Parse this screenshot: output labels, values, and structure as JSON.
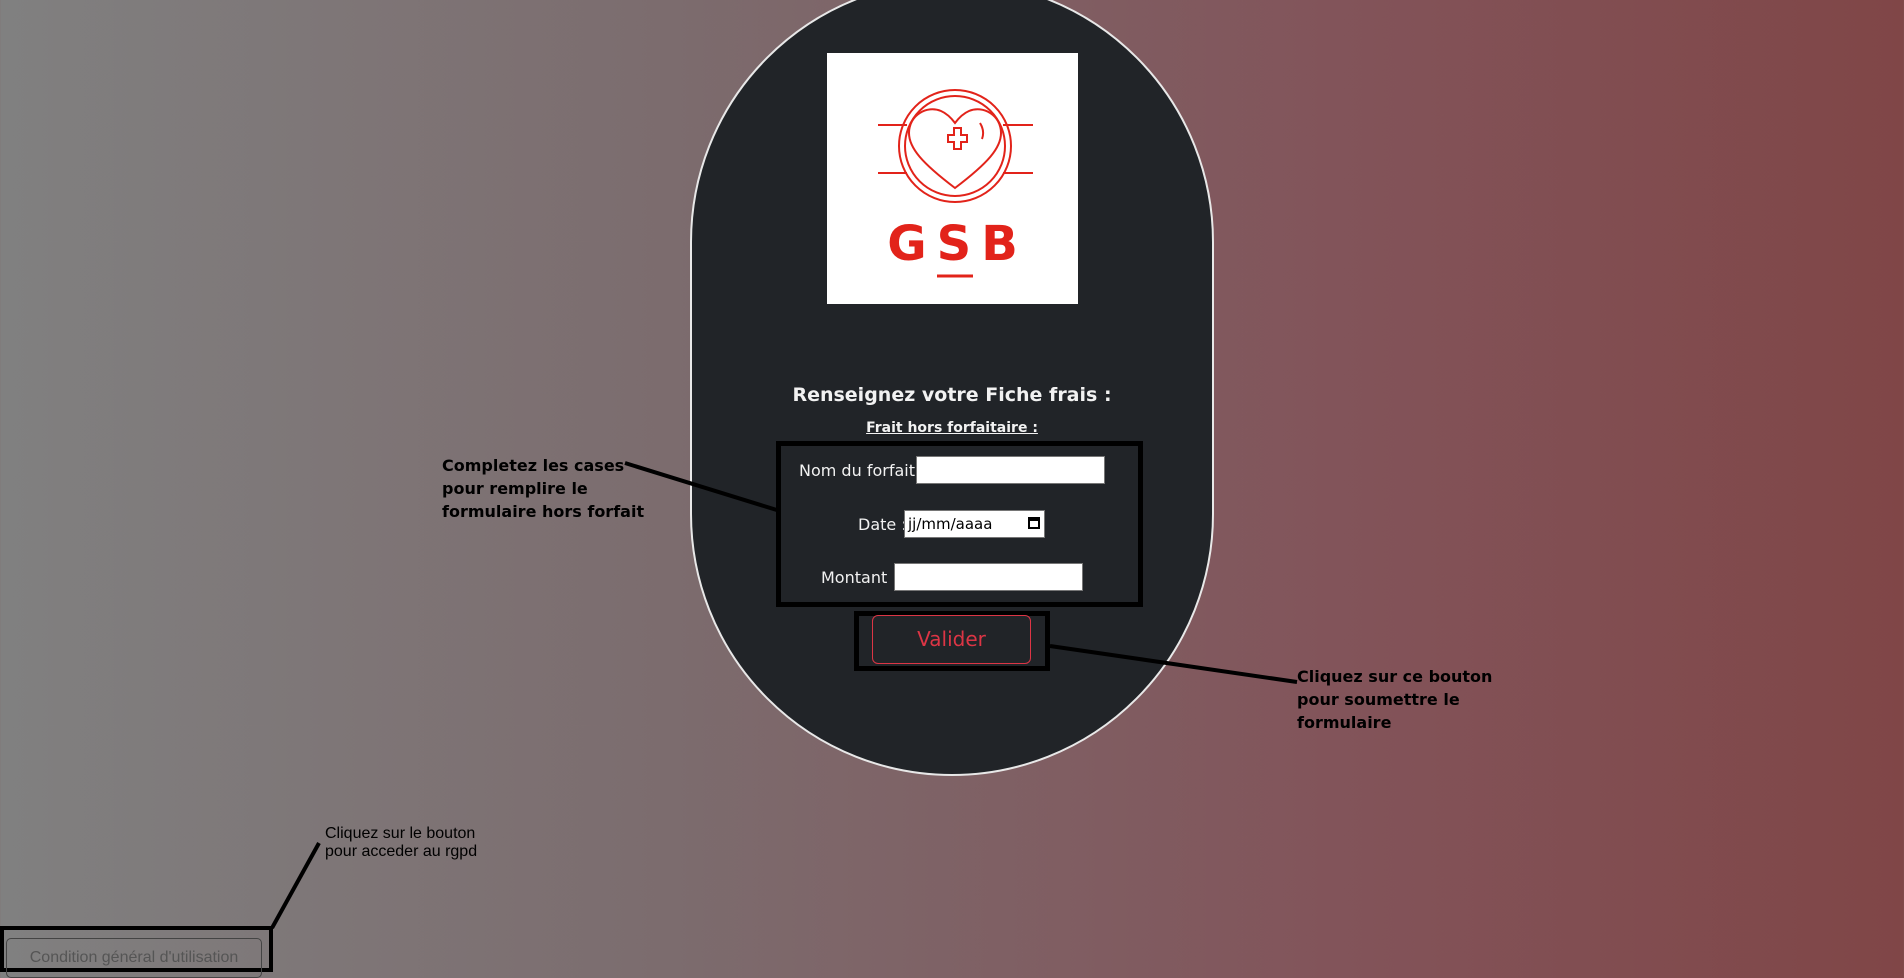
{
  "logo": {
    "text": "GSB",
    "color": "#e2231a"
  },
  "form": {
    "heading": "Renseignez votre Fiche frais :",
    "subheading": "Frait hors forfaitaire :",
    "fields": [
      {
        "label": "Nom du forfait :",
        "value": ""
      },
      {
        "label": "Date :",
        "placeholder": "jj/mm/aaaa"
      },
      {
        "label": "Montant :",
        "value": ""
      }
    ],
    "submit_label": "Valider"
  },
  "annotations": {
    "form": [
      "Completez les cases",
      "pour remplire le",
      "formulaire hors forfait"
    ],
    "submit": [
      "Cliquez sur ce bouton",
      "pour soumettre le",
      "formulaire"
    ],
    "rgpd": [
      "Cliquez sur le bouton",
      "pour acceder au rgpd"
    ]
  },
  "footer": {
    "cgu_label": "Condition général d'utilisation"
  },
  "colors": {
    "accent": "#dc3545",
    "panel": "#212428"
  }
}
